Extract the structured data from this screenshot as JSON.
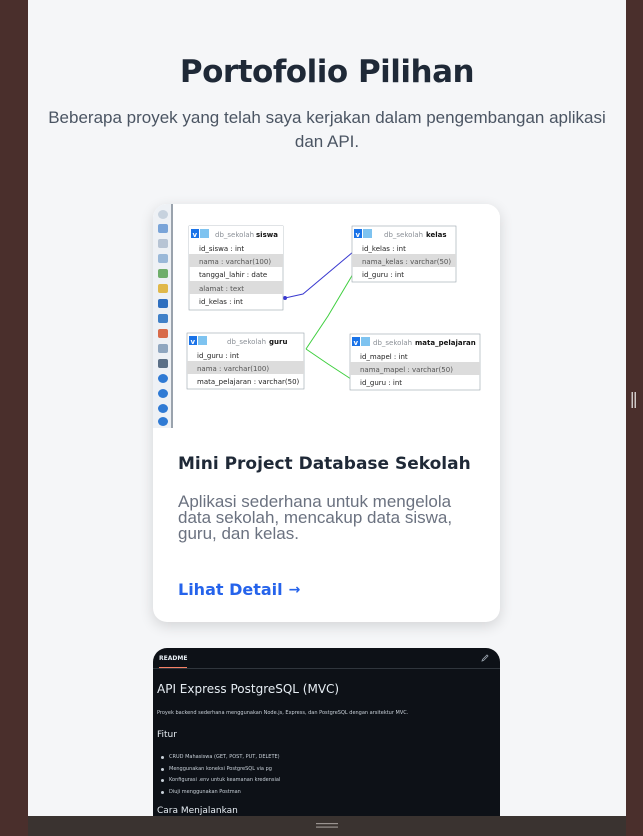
{
  "section": {
    "title": "Portofolio Pilihan",
    "subtitle": "Beberapa proyek yang telah saya kerjakan dalam pengembangan aplikasi dan API."
  },
  "projects": [
    {
      "title": "Mini Project Database Sekolah",
      "description": "Aplikasi sederhana untuk mengelola data sekolah, mencakup data siswa, guru, dan kelas.",
      "link_label": "Lihat Detail"
    }
  ],
  "diagram": {
    "tables": [
      {
        "db": "db_sekolah",
        "name": "siswa",
        "fields": [
          "id_siswa : int",
          "nama : varchar(100)",
          "tanggal_lahir : date",
          "alamat : text",
          "id_kelas : int"
        ]
      },
      {
        "db": "db_sekolah",
        "name": "kelas",
        "fields": [
          "id_kelas : int",
          "nama_kelas : varchar(50)",
          "id_guru : int"
        ]
      },
      {
        "db": "db_sekolah",
        "name": "guru",
        "fields": [
          "id_guru : int",
          "nama : varchar(100)",
          "mata_pelajaran : varchar(50)"
        ]
      },
      {
        "db": "db_sekolah",
        "name": "mata_pelajaran",
        "fields": [
          "id_mapel : int",
          "nama_mapel : varchar(50)",
          "id_guru : int"
        ]
      }
    ]
  },
  "readme": {
    "tab": "README",
    "title": "API Express PostgreSQL (MVC)",
    "intro": "Proyek backend sederhana menggunakan Node.js, Express, dan PostgreSQL dengan arsitektur MVC.",
    "features_heading": "Fitur",
    "features": [
      "CRUD Mahasiswa (GET, POST, PUT, DELETE)",
      "Menggunakan koneksi PostgreSQL via pg",
      "Konfigurasi .env untuk keamanan kredensial",
      "Diuji menggunakan Postman"
    ],
    "run_heading": "Cara Menjalankan"
  },
  "colors": {
    "accent": "#2563eb",
    "title": "#1f2937",
    "readme_bg": "#0d1117"
  }
}
